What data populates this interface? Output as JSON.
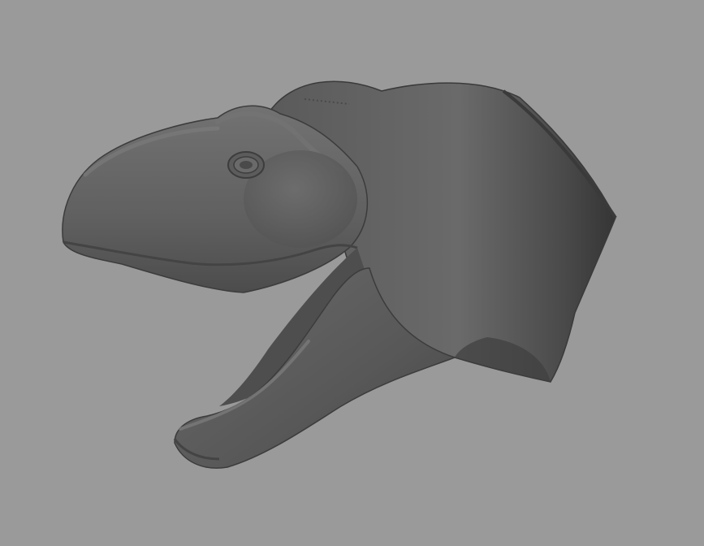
{
  "viewport": {
    "background_color": "#9a9a9a",
    "subject": "dinosaur-head-3d-model",
    "shading": "smooth-grey-clay",
    "model_colors": {
      "base": "#5e5e5e",
      "highlight": "#7c7c7c",
      "shadow": "#3c3c3c",
      "mouth_interior": "#565656",
      "outline": "#2e2e2e"
    }
  }
}
